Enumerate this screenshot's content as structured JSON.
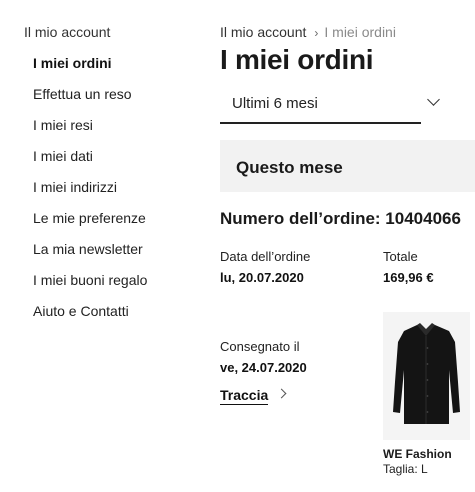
{
  "sidebar": {
    "heading": "Il mio account",
    "items": [
      {
        "label": "I miei ordini",
        "active": true
      },
      {
        "label": "Effettua un reso"
      },
      {
        "label": "I miei resi"
      },
      {
        "label": "I miei dati"
      },
      {
        "label": "I miei indirizzi"
      },
      {
        "label": "Le mie preferenze"
      },
      {
        "label": "La mia newsletter"
      },
      {
        "label": "I miei buoni regalo"
      },
      {
        "label": "Aiuto e Contatti"
      }
    ]
  },
  "breadcrumb": {
    "root": "Il mio account",
    "current": "I miei ordini"
  },
  "page": {
    "title": "I miei ordini"
  },
  "filter": {
    "selected": "Ultimi 6 mesi"
  },
  "section": {
    "month_label": "Questo mese"
  },
  "order": {
    "number_label": "Numero dell’ordine: 10404066",
    "date_label": "Data dell’ordine",
    "date_value": "lu, 20.07.2020",
    "total_label": "Totale",
    "total_value": "169,96 €",
    "delivered_label": "Consegnato il",
    "delivered_value": "ve, 24.07.2020",
    "track_label": "Traccia"
  },
  "product": {
    "brand": "WE Fashion",
    "size": "Taglia: L"
  },
  "colors": {
    "background": "#ffffff",
    "panel": "#f2f2f2",
    "text": "#1a1a1a",
    "muted": "#8a8a8a"
  }
}
